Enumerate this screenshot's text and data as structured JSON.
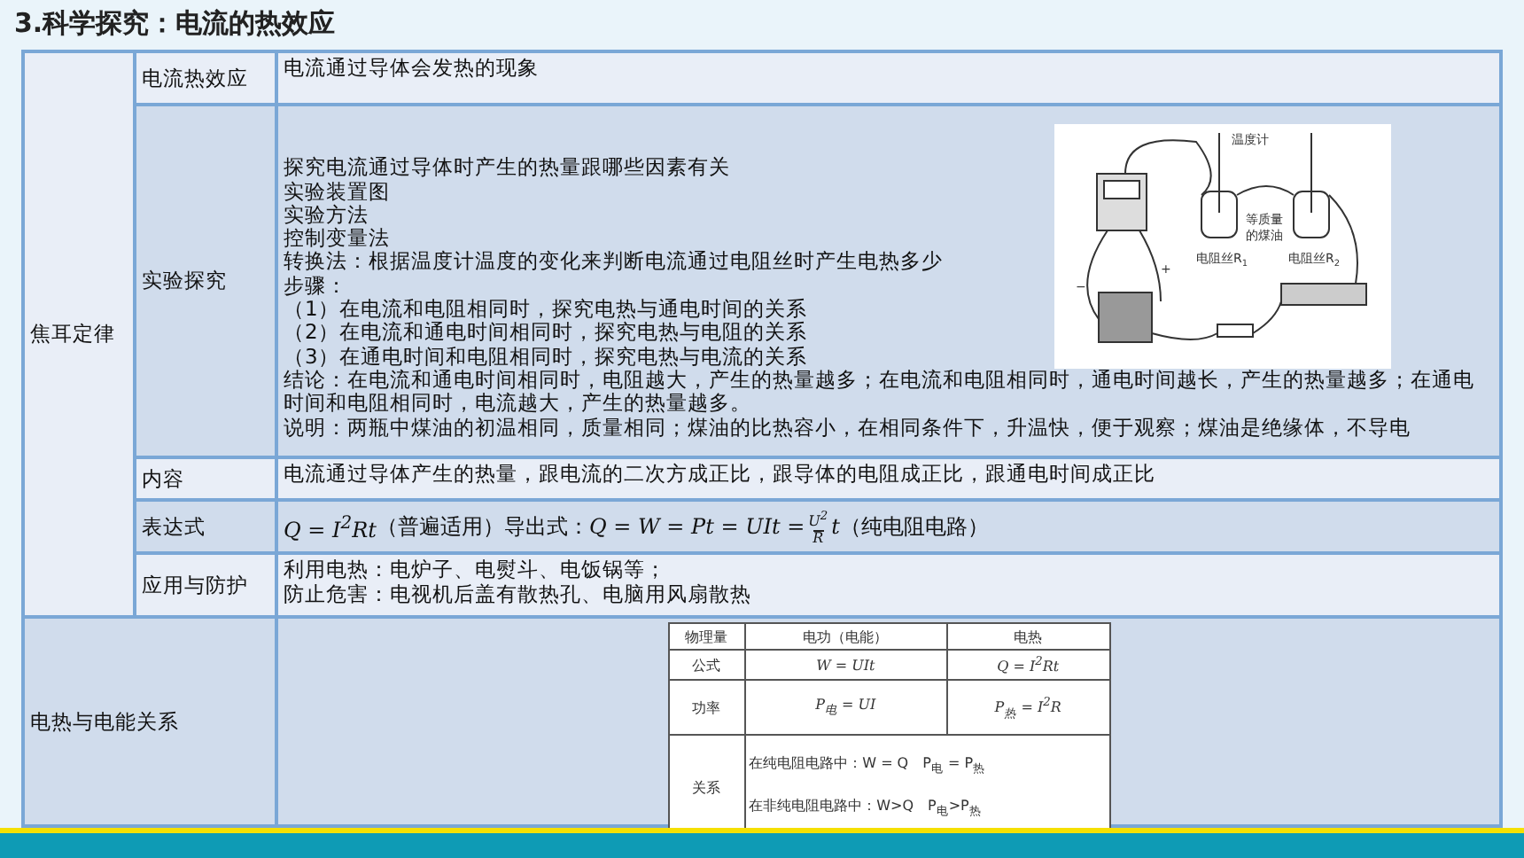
{
  "title": "3.科学探究：电流的热效应",
  "joule_law": {
    "label": "焦耳定律",
    "rows": [
      {
        "kind": "text",
        "label": "电流热效应",
        "lines": [
          "电流通过导体会发热的现象"
        ]
      },
      {
        "kind": "experiment",
        "label": "实验探究",
        "lines": [
          "探究电流通过导体时产生的热量跟哪些因素有关",
          "实验装置图",
          "实验方法",
          "控制变量法",
          "转换法：根据温度计温度的变化来判断电流通过电阻丝时产生电热多少",
          "步骤：",
          "（1）在电流和电阻相同时，探究电热与通电时间的关系",
          "（2）在电流和通电时间相同时，探究电热与电阻的关系",
          "（3）在通电时间和电阻相同时，探究电热与电流的关系",
          "结论：在电流和通电时间相同时，电阻越大，产生的热量越多；在电流和电阻相同时，通电时间越长，产生的热量越多；在通电时间和电阻相同时，电流越大，产生的热量越多。",
          "说明：两瓶中煤油的初温相同，质量相同；煤油的比热容小，在相同条件下，升温快，便于观察；煤油是绝缘体，不导电"
        ],
        "diagram_labels": [
          "温度计",
          "等质量",
          "的煤油",
          "电阻丝R$_{1}$",
          "电阻丝R$_{2}$",
          "+",
          "−"
        ]
      },
      {
        "kind": "text",
        "label": "内容",
        "lines": [
          "电流通过导体产生的热量，跟电流的二次方成正比，跟导体的电阻成正比，跟通电时间成正比"
        ]
      },
      {
        "kind": "formula",
        "label": "表达式",
        "formula": "Q = I$^{2}$Rt",
        "note": "（普遍适用）",
        "derived_label": "导出式：",
        "derived_formula": "Q = W = Pt = UIt =",
        "fraction_num": "U$^{2}$",
        "fraction_den": "R",
        "derived_tail": "t",
        "derived_note": "（纯电阻电路）"
      },
      {
        "kind": "text",
        "label": "应用与防护",
        "lines": [
          "利用电热：电炉子、电熨斗、电饭锅等；",
          "防止危害：电视机后盖有散热孔、电脑用风扇散热"
        ]
      }
    ]
  },
  "relation": {
    "label": "电热与电能关系",
    "table": {
      "header": [
        "物理量",
        "电功（电能）",
        "电热"
      ],
      "formula_row": [
        "公式",
        "W = UIt",
        "Q = I$^{2}$Rt"
      ],
      "power_row": [
        "功率",
        "P$_{电}$ = UI",
        "P$_{热}$ = I$^{2}$R"
      ],
      "relation_row": {
        "label": "关系",
        "lines": [
          "在纯电阻电路中：W = Q　P$_{电}$ = P$_{热}$",
          "在非纯电阻电路中：W>Q　P$_{电}$>P$_{热}$"
        ]
      }
    }
  }
}
